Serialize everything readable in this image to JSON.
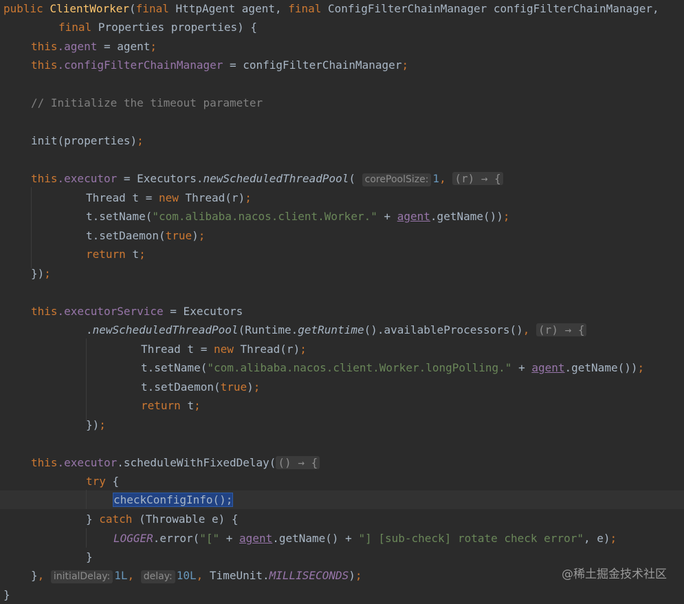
{
  "line1": {
    "kw1": "public ",
    "fn": "ClientWorker",
    "p1": "(",
    "kw2": "final ",
    "t1": "HttpAgent agent, ",
    "kw3": "final ",
    "t2": "ConfigFilterChainManager configFilterChainManager,"
  },
  "line2": {
    "kw": "final ",
    "t": "Properties properties) {"
  },
  "line3": {
    "kw": "this",
    "fld": ".agent",
    "t": " = agent",
    "sc": ";"
  },
  "line4": {
    "kw": "this",
    "fld": ".configFilterChainManager",
    "t": " = configFilterChainManager",
    "sc": ";"
  },
  "line5": {
    "cm": "// Initialize the timeout parameter"
  },
  "line6": {
    "t": "init(properties)",
    "sc": ";"
  },
  "line7": {
    "kw": "this",
    "fld": ".executor",
    "t1": " = Executors.",
    "it": "newScheduledThreadPool",
    "p": "(",
    "hint": "corePoolSize:",
    "num": "1",
    "c": ", ",
    "lam": "(r) → {"
  },
  "line8": {
    "t1": "Thread t = ",
    "kw": "new ",
    "t2": "Thread(r)",
    "sc": ";"
  },
  "line9": {
    "t1": "t.setName(",
    "str": "\"com.alibaba.nacos.client.Worker.\"",
    "t2": " + ",
    "fld": "agent",
    "t3": ".getName())",
    "sc": ";"
  },
  "line10": {
    "t1": "t.setDaemon(",
    "kw": "true",
    "t2": ")",
    "sc": ";"
  },
  "line11": {
    "kw": "return ",
    "t": "t",
    "sc": ";"
  },
  "line12": {
    "t1": "}",
    "t2": ")",
    "sc": ";"
  },
  "line13": {
    "kw": "this",
    "fld": ".executorService",
    "t": " = Executors"
  },
  "line14": {
    "t1": ".",
    "it": "newScheduledThreadPool",
    "t2": "(Runtime.",
    "it2": "getRuntime",
    "t3": "().availableProcessors()",
    "c": ", ",
    "lam": "(r) → {"
  },
  "line15": {
    "t1": "Thread t = ",
    "kw": "new ",
    "t2": "Thread(r)",
    "sc": ";"
  },
  "line16": {
    "t1": "t.setName(",
    "str": "\"com.alibaba.nacos.client.Worker.longPolling.\"",
    "t2": " + ",
    "fld": "agent",
    "t3": ".getName())",
    "sc": ";"
  },
  "line17": {
    "t1": "t.setDaemon(",
    "kw": "true",
    "t2": ")",
    "sc": ";"
  },
  "line18": {
    "kw": "return ",
    "t": "t",
    "sc": ";"
  },
  "line19": {
    "t1": "}",
    "t2": ")",
    "sc": ";"
  },
  "line20": {
    "kw": "this",
    "fld": ".executor",
    "t": ".scheduleWithFixedDelay(",
    "lam": "() → {"
  },
  "line21": {
    "kw": "try ",
    "t": "{"
  },
  "line22": {
    "sel": "checkConfigInfo();"
  },
  "line23": {
    "t1": "} ",
    "kw": "catch ",
    "t2": "(Throwable e) {"
  },
  "line24": {
    "fld": "LOGGER",
    "t1": ".error(",
    "str1": "\"[\"",
    "t2": " + ",
    "fld2": "agent",
    "t3": ".getName() + ",
    "str2": "\"] [sub-check] rotate check error\"",
    "t4": ", e)",
    "sc": ";"
  },
  "line25": {
    "t": "}"
  },
  "line26": {
    "t1": "}",
    "c1": ", ",
    "h1": "initialDelay:",
    "n1": "1L",
    "c2": ", ",
    "h2": "delay:",
    "n2": "10L",
    "c3": ", ",
    "t2": "TimeUnit.",
    "it": "MILLISECONDS",
    "t3": ")",
    "sc": ";"
  },
  "line27": {
    "t": "}"
  },
  "watermark": "@稀土掘金技术社区",
  "colors": {
    "background": "#2b2b2b",
    "keyword": "#cc7832",
    "method": "#ffc66d",
    "field": "#9876aa",
    "string": "#6a8759",
    "number": "#6897bb",
    "comment": "#808080",
    "selection": "#214283"
  }
}
